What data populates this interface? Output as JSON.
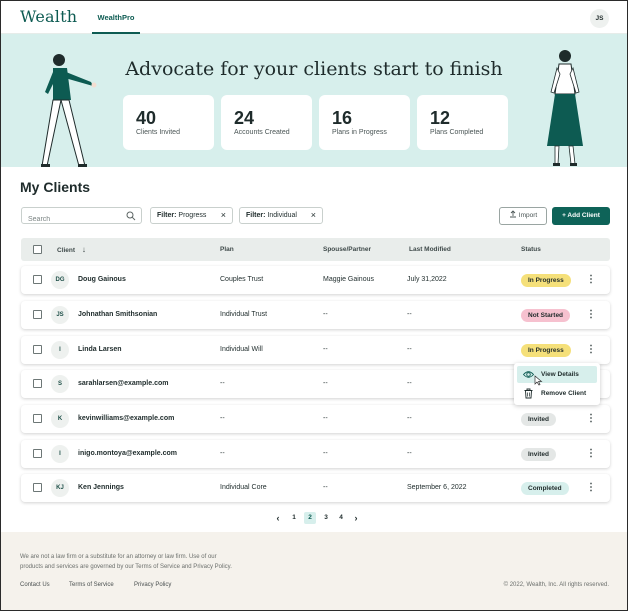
{
  "app": {
    "logo": "Wealth",
    "nav_tab": "WealthPro",
    "user_initials": "JS"
  },
  "hero": {
    "title": "Advocate for your clients start to finish",
    "stats": [
      {
        "value": "40",
        "label": "Clients Invited"
      },
      {
        "value": "24",
        "label": "Accounts Created"
      },
      {
        "value": "16",
        "label": "Plans in Progress"
      },
      {
        "value": "12",
        "label": "Plans Completed"
      }
    ]
  },
  "clients": {
    "title": "My Clients",
    "search_placeholder": "Search",
    "filters": [
      {
        "key": "Filter:",
        "value": "Progress"
      },
      {
        "key": "Filter:",
        "value": "Individual"
      }
    ],
    "import_label": "Import",
    "add_label": "+ Add Client",
    "columns": {
      "client": "Client",
      "sort_arrow": "↓",
      "plan": "Plan",
      "spouse": "Spouse/Partner",
      "modified": "Last Modified",
      "status": "Status"
    },
    "rows": [
      {
        "initials": "DG",
        "name": "Doug Gainous",
        "plan": "Couples Trust",
        "spouse": "Maggie Gainous",
        "modified": "July 31,2022",
        "status": "In Progress"
      },
      {
        "initials": "JS",
        "name": "Johnathan Smithsonian",
        "plan": "Individual Trust",
        "spouse": "--",
        "modified": "--",
        "status": "Not Started"
      },
      {
        "initials": "l",
        "name": "Linda Larsen",
        "plan": "Individual Will",
        "spouse": "--",
        "modified": "--",
        "status": "In Progress"
      },
      {
        "initials": "S",
        "name": "sarahlarsen@example.com",
        "plan": "--",
        "spouse": "--",
        "modified": "--",
        "status": ""
      },
      {
        "initials": "K",
        "name": "kevinwilliams@example.com",
        "plan": "--",
        "spouse": "--",
        "modified": "--",
        "status": "Invited"
      },
      {
        "initials": "I",
        "name": "inigo.montoya@example.com",
        "plan": "--",
        "spouse": "--",
        "modified": "--",
        "status": "Invited"
      },
      {
        "initials": "KJ",
        "name": "Ken Jennings",
        "plan": "Individual Core",
        "spouse": "--",
        "modified": "September 6, 2022",
        "status": "Completed"
      }
    ],
    "row_menu": {
      "view": "View Details",
      "remove": "Remove Client"
    },
    "pagination": {
      "prev": "‹",
      "pages": [
        "1",
        "2",
        "3",
        "4"
      ],
      "current": "2",
      "next": "›"
    }
  },
  "status_colors": {
    "In Progress": "#f5e07a",
    "Not Started": "#f6c1cf",
    "Invited": "#e4e7e6",
    "Completed": "#d7efec"
  },
  "footer": {
    "disclaimer": "We are not a law firm or a substitute for an attorney or law firm. Use of our products and services are governed by our Terms of Service and Privacy Policy.",
    "links": [
      "Contact Us",
      "Terms of Service",
      "Privacy Policy"
    ],
    "copyright": "© 2022, Wealth, Inc. All rights reserved."
  }
}
